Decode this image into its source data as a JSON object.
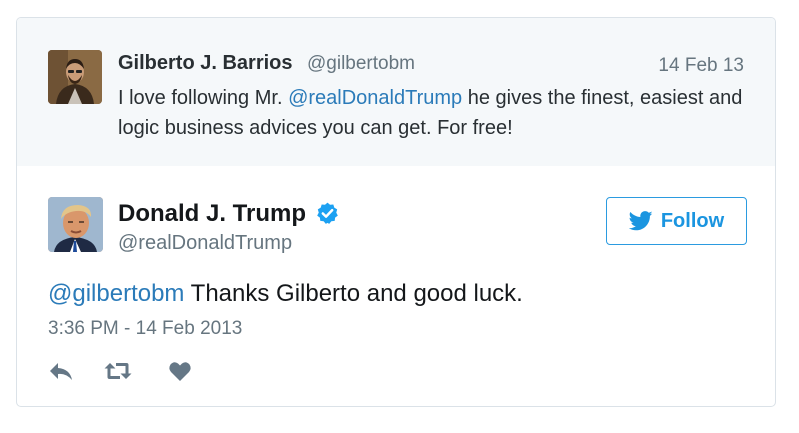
{
  "quoted_tweet": {
    "author_name": "Gilberto J. Barrios",
    "author_handle": "@gilbertobm",
    "date": "14 Feb 13",
    "text_before": "I love following Mr. ",
    "mention": "@realDonaldTrump",
    "text_after": " he gives the finest, easiest and logic business advices you can get. For free!"
  },
  "tweet": {
    "author_name": "Donald J. Trump",
    "author_handle": "@realDonaldTrump",
    "mention": "@gilbertobm",
    "text": " Thanks Gilberto and good luck.",
    "timestamp": "3:36 PM - 14 Feb 2013"
  },
  "follow_button": {
    "label": "Follow",
    "icon": "twitter-bird-icon"
  },
  "actions": [
    "reply-icon",
    "retweet-icon",
    "like-icon"
  ],
  "colors": {
    "link": "#2b7bb9",
    "follow": "#1b95e0",
    "verified": "#1da1f2",
    "muted": "#66757f",
    "quoted_bg": "#f5f8fa"
  }
}
